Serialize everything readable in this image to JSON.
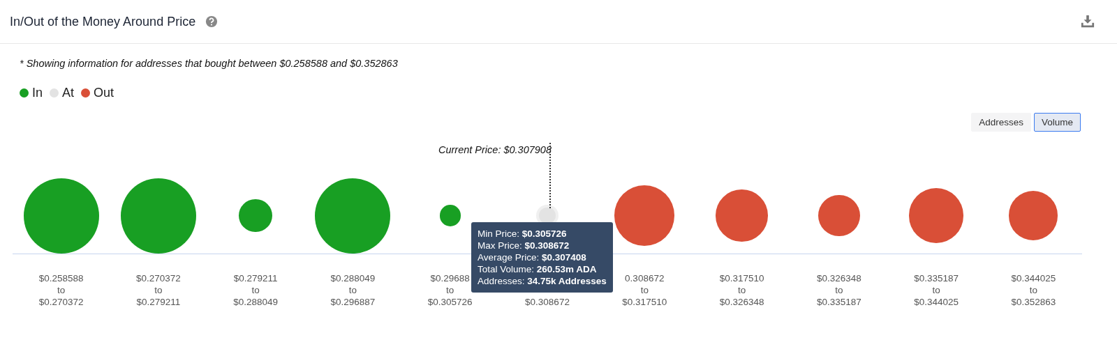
{
  "title": "In/Out of the Money Around Price",
  "note": "* Showing information for addresses that bought between $0.258588 and $0.352863",
  "legend": [
    {
      "label": "In",
      "color": "#189f23"
    },
    {
      "label": "At",
      "color": "#e3e3e3"
    },
    {
      "label": "Out",
      "color": "#d94f37"
    }
  ],
  "toggle": [
    {
      "label": "Addresses",
      "selected": false
    },
    {
      "label": "Volume",
      "selected": true
    }
  ],
  "current_price": "Current Price: $0.307908",
  "bubbles": [
    {
      "kind": "in",
      "lines": [
        "$0.258588",
        "to",
        "$0.270372"
      ]
    },
    {
      "kind": "in",
      "lines": [
        "$0.270372",
        "to",
        "$0.279211"
      ]
    },
    {
      "kind": "in",
      "lines": [
        "$0.279211",
        "to",
        "$0.288049"
      ]
    },
    {
      "kind": "in",
      "lines": [
        "$0.288049",
        "to",
        "$0.296887"
      ]
    },
    {
      "kind": "in",
      "lines": [
        "$0.29688",
        "to",
        "$0.305726"
      ]
    },
    {
      "kind": "at",
      "lines": [
        "$0.308672"
      ]
    },
    {
      "kind": "out",
      "lines": [
        "0.308672",
        "to",
        "$0.317510"
      ]
    },
    {
      "kind": "out",
      "lines": [
        "$0.317510",
        "to",
        "$0.326348"
      ]
    },
    {
      "kind": "out",
      "lines": [
        "$0.326348",
        "to",
        "$0.335187"
      ]
    },
    {
      "kind": "out",
      "lines": [
        "$0.335187",
        "to",
        "$0.344025"
      ]
    },
    {
      "kind": "out",
      "lines": [
        "$0.344025",
        "to",
        "$0.352863"
      ]
    }
  ],
  "tooltip": [
    {
      "label": "Min Price: ",
      "value": "$0.305726"
    },
    {
      "label": "Max Price: ",
      "value": "$0.308672"
    },
    {
      "label": "Average Price: ",
      "value": "$0.307408"
    },
    {
      "label": "Total Volume: ",
      "value": "260.53m ADA"
    },
    {
      "label": "Addresses: ",
      "value": "34.75k Addresses"
    }
  ]
}
